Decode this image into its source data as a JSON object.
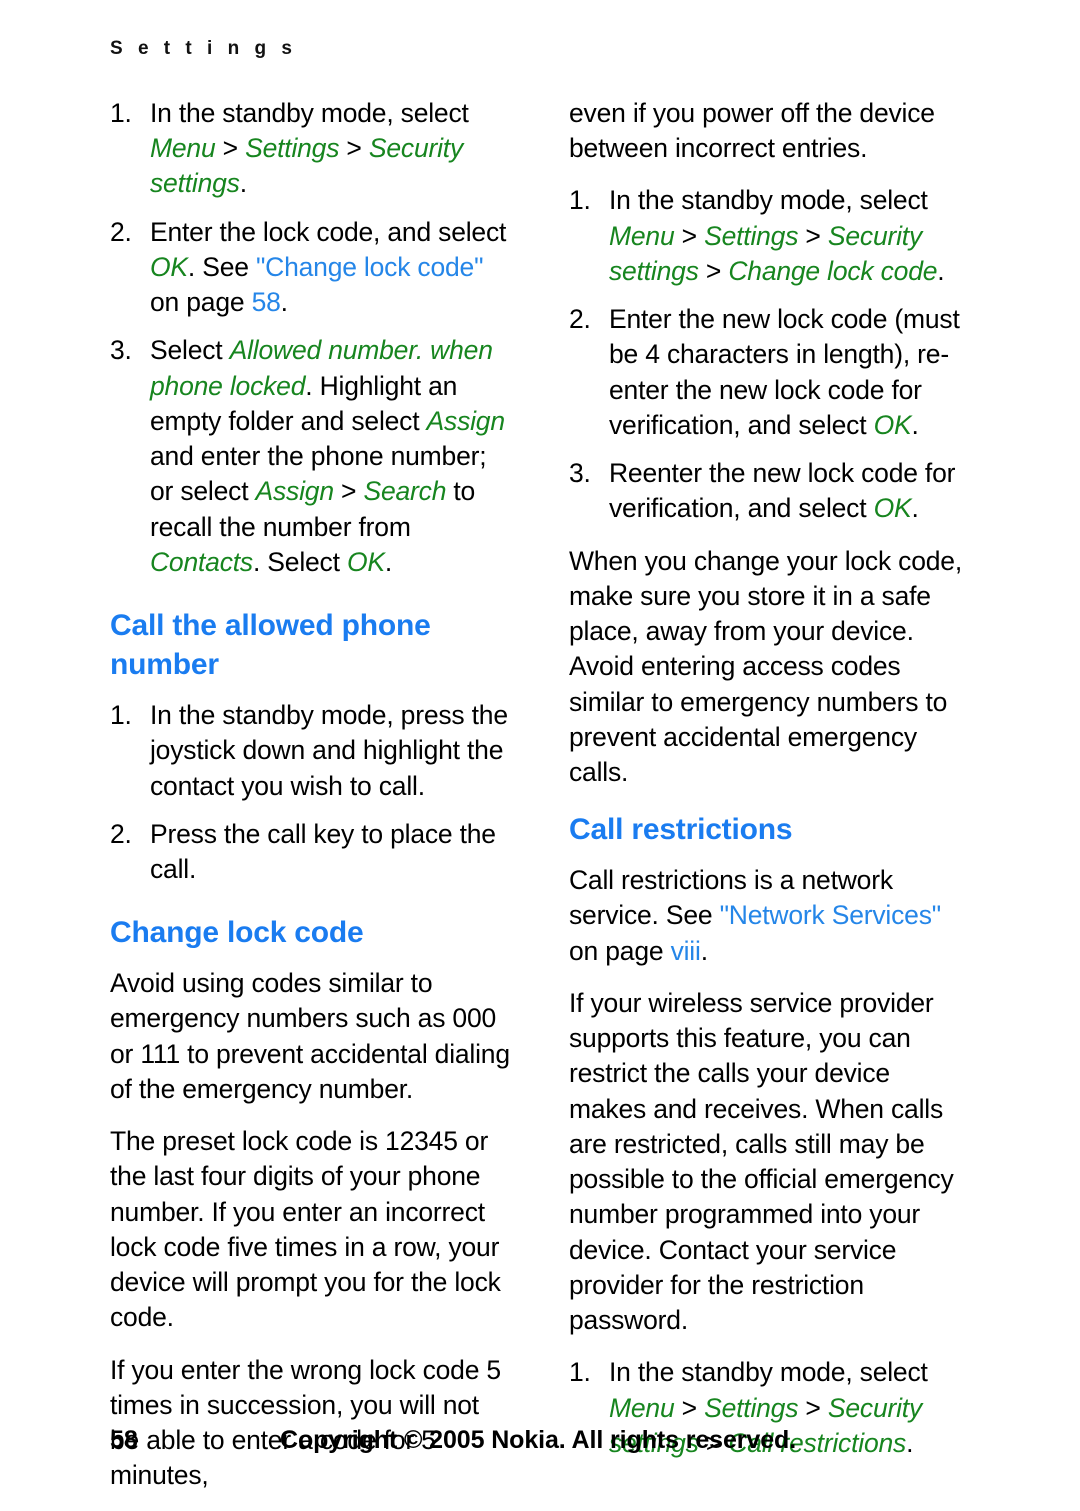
{
  "running_header": "S e t t i n g s",
  "left_column": {
    "steps_allowed_number": [
      {
        "number": "1.",
        "text_before": "In the standby mode, select ",
        "ui_path": [
          "Menu",
          "Settings",
          "Security settings"
        ],
        "text_after": "."
      },
      {
        "number": "2.",
        "text_before": "Enter the lock code, and select ",
        "ui_1": "OK",
        "mid_text": ". See ",
        "xref_title": "\"Change lock code\"",
        "mid_text_2": " on page ",
        "xref_page": "58",
        "text_after": "."
      },
      {
        "number": "3.",
        "seg_1": "Select ",
        "ui_1": "Allowed number. when phone locked",
        "seg_2": ". Highlight an empty folder and select ",
        "ui_2": "Assign",
        "seg_3": " and enter the phone number; or select ",
        "ui_3": "Assign",
        "sep_1": " > ",
        "ui_4": "Search",
        "seg_4": " to recall the number from ",
        "ui_5": "Contacts",
        "seg_5": ". Select ",
        "ui_6": "OK",
        "seg_6": "."
      }
    ],
    "heading_call_allowed": "Call the allowed phone number",
    "steps_call_allowed": [
      {
        "number": "1.",
        "text": "In the standby mode, press the joystick down and highlight the contact you wish to call."
      },
      {
        "number": "2.",
        "text": "Press the call key to place the call."
      }
    ],
    "heading_change_lock_code": "Change lock code",
    "para_avoid_codes": "Avoid using codes similar to emergency numbers such as 000 or 111 to prevent accidental dialing of the emergency number.",
    "para_preset_code": "The preset lock code is 12345 or the last four digits of your phone number. If you enter an incorrect lock code five times in a row, your device will prompt you for the lock code.",
    "para_wrong_code_start": "If you enter the wrong lock code 5 times in succession, you will not be able to enter a code for 5 minutes,"
  },
  "right_column": {
    "para_wrong_code_end": "even if you power off the device between incorrect entries.",
    "steps_change_lock_code": [
      {
        "number": "1.",
        "text_before": "In the standby mode, select ",
        "ui_path": [
          "Menu",
          "Settings",
          "Security settings",
          "Change lock code"
        ],
        "text_after": "."
      },
      {
        "number": "2.",
        "text_before": "Enter the new lock code (must be 4 characters in length), re-enter the new lock code for verification, and select ",
        "ui_1": "OK",
        "text_after": "."
      },
      {
        "number": "3.",
        "text_before": "Reenter the new lock code for verification, and select ",
        "ui_1": "OK",
        "text_after": "."
      }
    ],
    "para_store_safe": "When you change your lock code, make sure you store it in a safe place, away from your device. Avoid entering access codes similar to emergency numbers to prevent accidental emergency calls.",
    "heading_call_restrictions": "Call restrictions",
    "para_network_service_before": "Call restrictions is a network service. See ",
    "para_network_service_xref": "\"Network Services\"",
    "para_network_service_mid": " on page ",
    "para_network_service_page": "viii",
    "para_network_service_after": ".",
    "para_provider": "If your wireless service provider supports this feature, you can restrict the calls your device makes and receives. When calls are restricted, calls still may be possible to the official emergency number programmed into your device. Contact your service provider for the restriction password.",
    "steps_call_restrictions": [
      {
        "number": "1.",
        "text_before": "In the standby mode, select ",
        "ui_path": [
          "Menu",
          "Settings",
          "Security settings",
          "Call restrictions"
        ],
        "text_after": "."
      }
    ]
  },
  "footer": {
    "page_number": "58",
    "copyright": "Copyright © 2005 Nokia. All rights reserved."
  },
  "colors": {
    "heading_blue": "#1a7cf0",
    "ui_green": "#17851f",
    "xref_blue": "#2586e8",
    "body_text": "#000000",
    "background": "#ffffff"
  }
}
